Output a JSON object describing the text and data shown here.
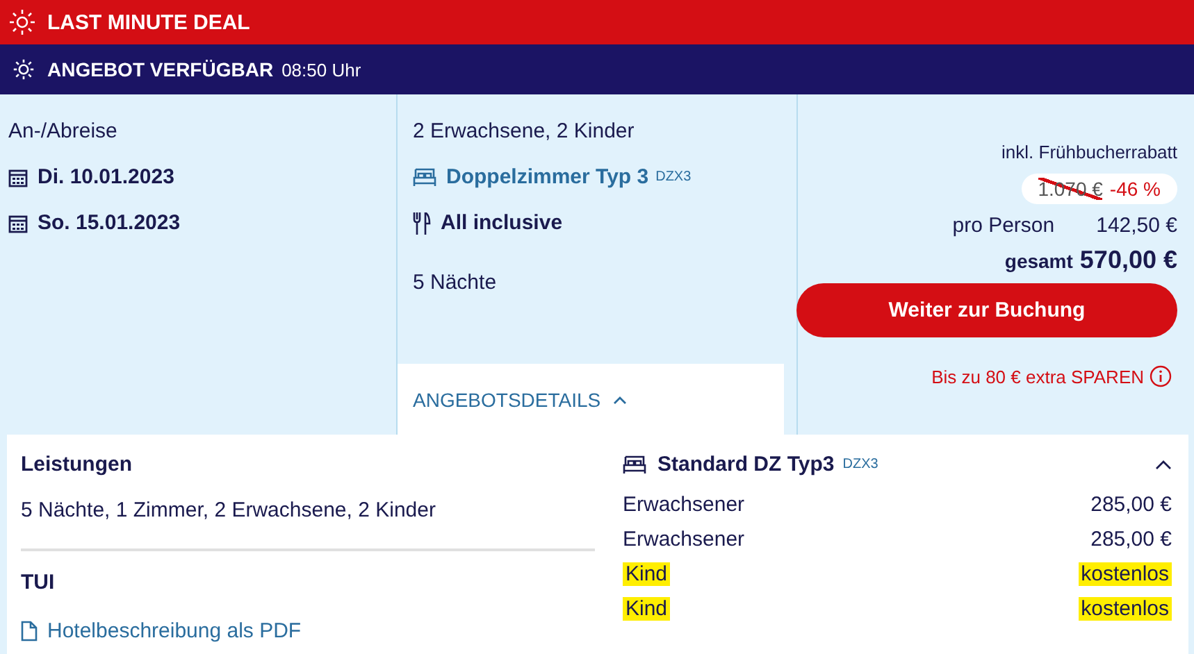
{
  "deal_banner": {
    "label": "LAST MINUTE DEAL"
  },
  "availability_banner": {
    "label": "ANGEBOT VERFÜGBAR",
    "time": "08:50 Uhr"
  },
  "travel_dates": {
    "heading": "An-/Abreise",
    "arrival": "Di. 10.01.2023",
    "departure": "So. 15.01.2023"
  },
  "offer": {
    "travellers": "2 Erwachsene, 2 Kinder",
    "room": "Doppelzimmer Typ 3",
    "room_code": "DZX3",
    "board": "All inclusive",
    "nights": "5 Nächte",
    "details_tab": {
      "label": "ANGEBOTSDETAILS",
      "expanded": true
    }
  },
  "price": {
    "discount_note": "inkl. Frühbucherrabatt",
    "old_price": "1.070 €",
    "old_price_struck": true,
    "discount": "-46 %",
    "per_person_label": "pro Person",
    "per_person": "142,50 €",
    "total_label": "gesamt",
    "total": "570,00 €",
    "book_button": "Weiter zur Buchung",
    "savings_link": "Bis zu 80 € extra SPAREN"
  },
  "details": {
    "services_heading": "Leistungen",
    "services": "5 Nächte, 1 Zimmer, 2 Erwachsene, 2 Kinder",
    "operator": "TUI",
    "pdf_link": "Hotelbeschreibung als PDF",
    "room": {
      "name": "Standard DZ Typ3",
      "code": "DZX3",
      "expanded": true,
      "rows": [
        {
          "label": "Erwachsener",
          "price": "285,00 €",
          "highlighted": false
        },
        {
          "label": "Erwachsener",
          "price": "285,00 €",
          "highlighted": false
        },
        {
          "label": "Kind",
          "price": "kostenlos",
          "highlighted": true
        },
        {
          "label": "Kind",
          "price": "kostenlos",
          "highlighted": true
        }
      ]
    }
  }
}
